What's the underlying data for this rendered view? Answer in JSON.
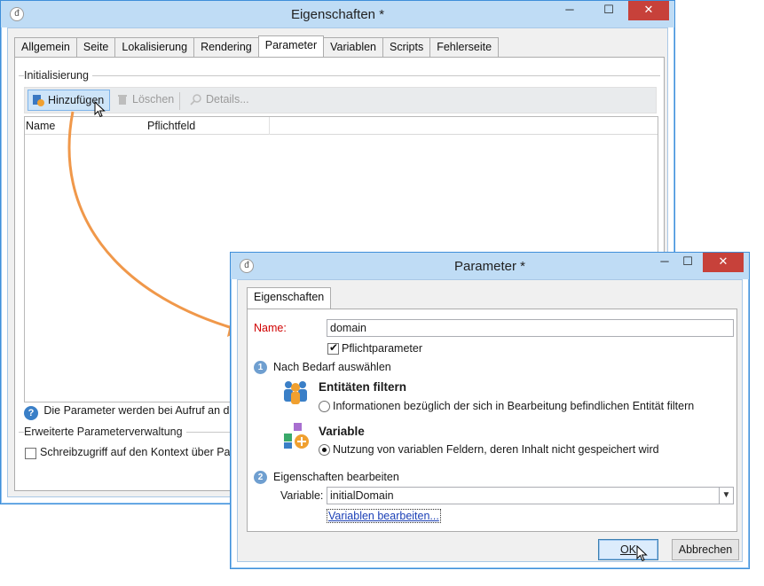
{
  "main_window": {
    "title": "Eigenschaften *",
    "controls": {
      "minimize": "─",
      "maximize": "☐",
      "close": "✕"
    },
    "tabs": [
      {
        "label": "Allgemein",
        "active": false
      },
      {
        "label": "Seite",
        "active": false
      },
      {
        "label": "Lokalisierung",
        "active": false
      },
      {
        "label": "Rendering",
        "active": false
      },
      {
        "label": "Parameter",
        "active": true
      },
      {
        "label": "Variablen",
        "active": false
      },
      {
        "label": "Scripts",
        "active": false
      },
      {
        "label": "Fehlerseite",
        "active": false
      }
    ],
    "init_group": "Initialisierung",
    "toolbar": {
      "add": "Hinzufügen",
      "delete": "Löschen",
      "details": "Details..."
    },
    "grid_headers": [
      "Name",
      "Pflichtfeld"
    ],
    "hint": "Die Parameter werden bei Aufruf an die",
    "advanced_group": "Erweiterte Parameterverwaltung",
    "write_access": "Schreibzugriff auf den Kontext über Paran"
  },
  "dialog": {
    "title": "Parameter *",
    "controls": {
      "minimize": "─",
      "maximize": "☐",
      "close": "✕"
    },
    "tab": "Eigenschaften",
    "name_label": "Name:",
    "name_value": "domain",
    "required_label": "Pflichtparameter",
    "required_checked": true,
    "step1_number": "1",
    "step1_label": "Nach Bedarf auswählen",
    "entity_title": "Entitäten filtern",
    "entity_option": "Informationen bezüglich der sich in Bearbeitung befindlichen Entität filtern",
    "entity_selected": false,
    "variable_title": "Variable",
    "variable_option": "Nutzung von variablen Feldern, deren Inhalt nicht gespeichert wird",
    "variable_selected": true,
    "step2_number": "2",
    "step2_label": "Eigenschaften bearbeiten",
    "variable_label": "Variable:",
    "variable_value": "initialDomain",
    "edit_variables_link": "Variablen bearbeiten...",
    "ok": "OK",
    "cancel": "Abbrechen"
  },
  "colors": {
    "accent": "#3f8fd9",
    "arrow": "#f0984a",
    "required_label": "#d00000",
    "close_button": "#c7413a"
  },
  "icons": {
    "app": "app-logo-icon",
    "add": "add-parameter-icon",
    "delete": "trash-icon",
    "details": "magnifier-icon",
    "help": "question-icon",
    "entities": "people-icon",
    "variable": "variable-blocks-icon",
    "dropdown": "chevron-down-icon"
  }
}
